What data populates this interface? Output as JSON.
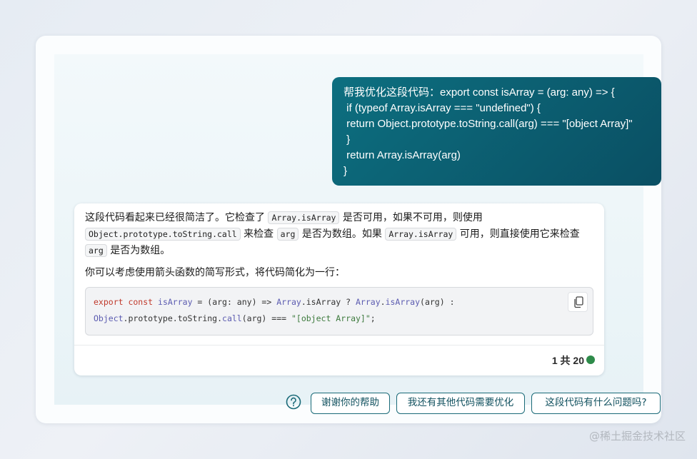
{
  "user_message": {
    "lines": [
      "帮我优化这段代码：export const isArray = (arg: any) => {",
      " if (typeof Array.isArray === \"undefined\") {",
      " return Object.prototype.toString.call(arg) === \"[object Array]\"",
      " }",
      " return Array.isArray(arg)",
      "}"
    ]
  },
  "bot_message": {
    "p1": {
      "t1": "这段代码看起来已经很简洁了。它检查了",
      "c1": "Array.isArray",
      "t2": "是否可用，如果不可用，则使用",
      "c2": "Object.prototype.toString.call",
      "t3": "来检查",
      "c3": "arg",
      "t4": "是否为数组。如果",
      "c4": "Array.isArray",
      "t5": "可用，则直接使用它来检查",
      "c5": "arg",
      "t6": "是否为数组。"
    },
    "p2": "你可以考虑使用箭头函数的简写形式，将代码简化为一行：",
    "code": {
      "l1": {
        "a": "export const",
        "b": " ",
        "c": "isArray",
        "d": " = (arg: any) => ",
        "e": "Array",
        "f": ".isArray ? ",
        "g": "Array",
        "h": ".",
        "i": "isArray",
        "j": "(arg) :"
      },
      "l2": {
        "a": "Object",
        "b": ".prototype.toString.",
        "c": "call",
        "d": "(arg) === ",
        "e": "\"[object Array]\"",
        "f": ";"
      }
    },
    "counter": "1 共 20"
  },
  "suggestions": [
    "谢谢你的帮助",
    "我还有其他代码需要优化",
    "这段代码有什么问题吗?"
  ],
  "watermark": "@稀土掘金技术社区",
  "colors": {
    "user_bubble": "#0a5b6e",
    "accent": "#1a6a78",
    "status_dot": "#2e8b4a"
  },
  "icons": {
    "copy": "copy-icon",
    "help": "help-circle-icon"
  }
}
